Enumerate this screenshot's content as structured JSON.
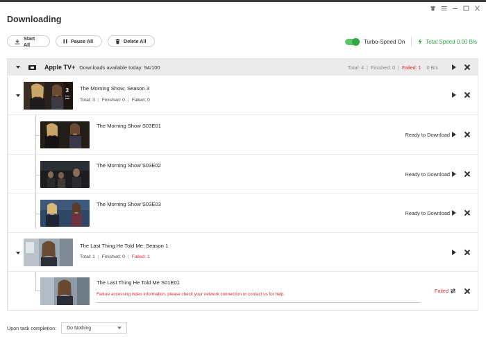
{
  "window": {
    "title": "Downloading",
    "controls": [
      "shirt-icon",
      "menu-icon",
      "minimize-icon",
      "maximize-icon",
      "close-icon"
    ]
  },
  "toolbar": {
    "start_all": "Start All",
    "pause_all": "Pause All",
    "delete_all": "Delete All"
  },
  "turbo": {
    "label": "Turbo-Speed On",
    "enabled": true,
    "total_speed": "Total Speed 0.00 B/s",
    "color": "#2fa83e"
  },
  "group": {
    "name": "Apple TV+",
    "available": "Downloads available today: 94/100",
    "total": "Total: 4",
    "finished": "Finished: 0",
    "failed": "Failed: 1",
    "rate": "0 B/s"
  },
  "seasons": [
    {
      "title": "The Morning Show: Season 3",
      "thumb_badge": "3",
      "total": "Total: 3",
      "finished": "Finished: 0",
      "failed": "Failed: 0",
      "episodes": [
        {
          "title": "The Morning Show S03E01",
          "status": "Ready to Download"
        },
        {
          "title": "The Morning Show S03E02",
          "status": "Ready to Download"
        },
        {
          "title": "The Morning Show S03E03",
          "status": "Ready to Download"
        }
      ]
    },
    {
      "title": "The Last Thing He Told Me: Season 1",
      "total": "Total: 1",
      "finished": "Finished: 0",
      "failed": "Failed: 1",
      "episodes": [
        {
          "title": "The Last Thing He Told Me S01E01",
          "status": "Failed",
          "error": "Failure accessing video information, please check your network connection or contact us for help."
        }
      ]
    }
  ],
  "footer": {
    "label": "Upon task completion:",
    "selected": "Do Nothing"
  },
  "colors": {
    "failed": "#d62c2c",
    "accent_green": "#2fa83e"
  }
}
